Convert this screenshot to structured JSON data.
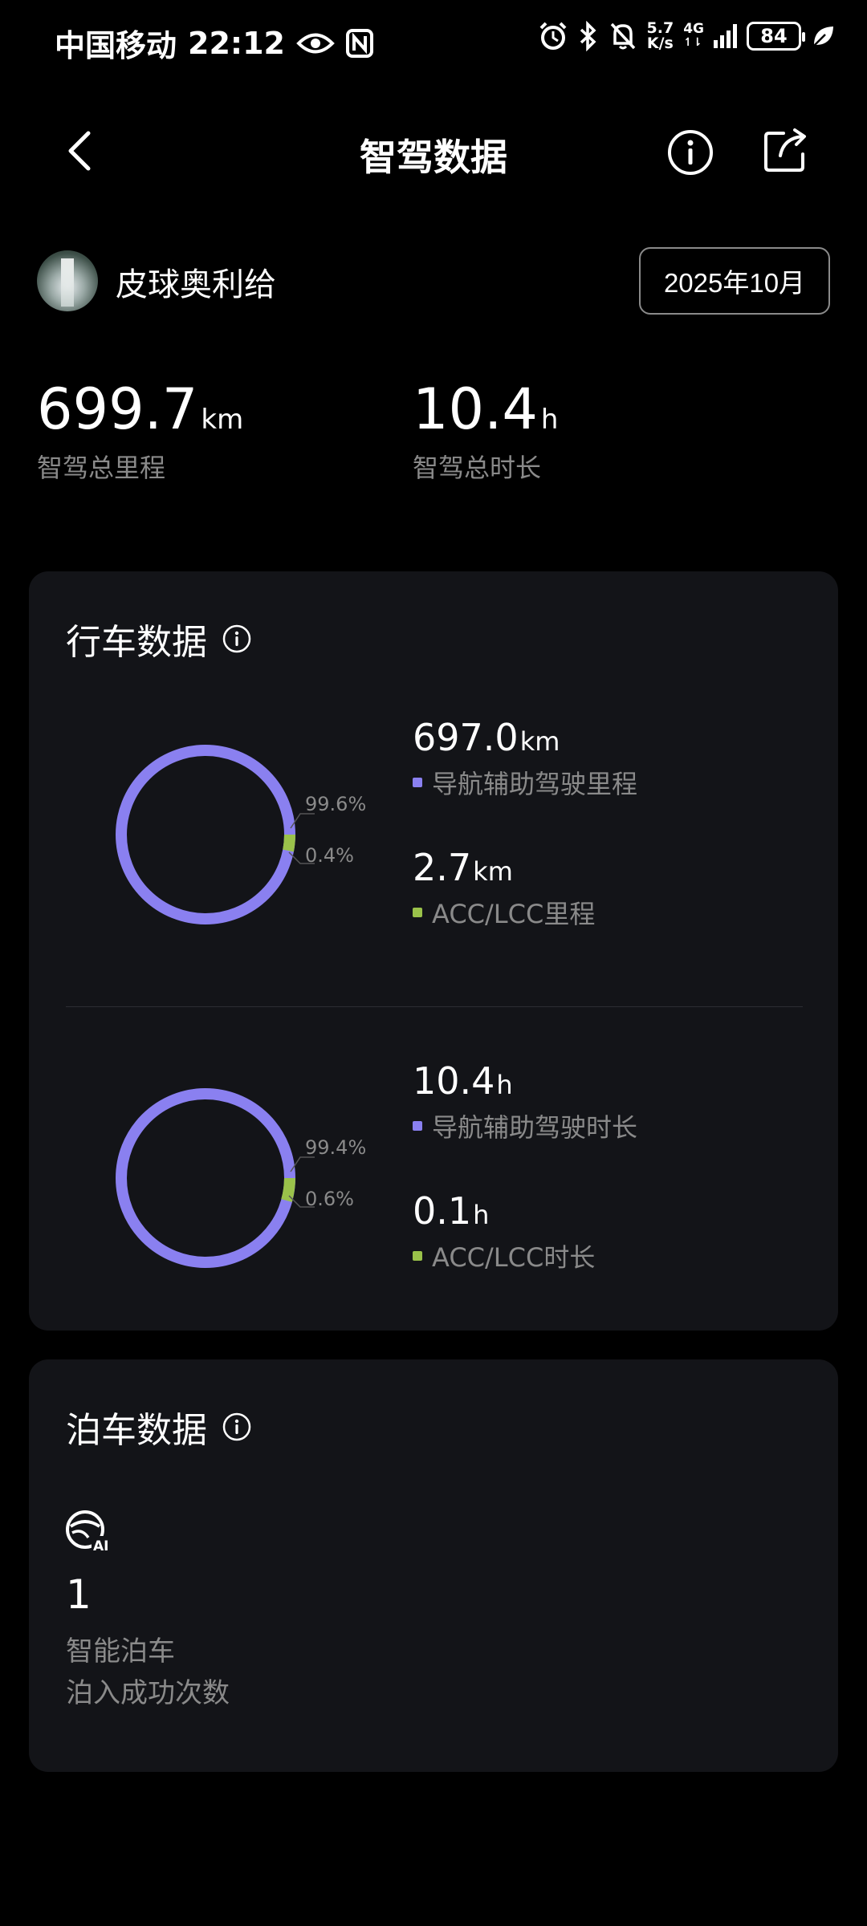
{
  "status_bar": {
    "carrier": "中国移动",
    "time": "22:12",
    "speed_top": "5.7",
    "speed_bottom": "K/s",
    "network": "4G",
    "battery": "84",
    "icons": [
      "eye-icon",
      "nfc-icon",
      "alarm-icon",
      "bluetooth-icon",
      "mute-bell-icon",
      "signal-icon",
      "battery-icon",
      "leaf-icon"
    ]
  },
  "header": {
    "title": "智驾数据",
    "back_icon": "back-arrow-icon",
    "info_icon": "info-icon",
    "share_icon": "share-icon"
  },
  "user": {
    "name": "皮球奥利给",
    "month": "2025年10月"
  },
  "totals": {
    "distance_value": "699.7",
    "distance_unit": "km",
    "distance_label": "智驾总里程",
    "duration_value": "10.4",
    "duration_unit": "h",
    "duration_label": "智驾总时长"
  },
  "driving": {
    "title": "行车数据",
    "colors": {
      "nav": "#8a80f0",
      "acc": "#9ac24a"
    },
    "distance": {
      "nav_pct": "99.6%",
      "acc_pct": "0.4%",
      "nav_value": "697.0",
      "nav_unit": "km",
      "nav_label": "导航辅助驾驶里程",
      "acc_value": "2.7",
      "acc_unit": "km",
      "acc_label": "ACC/LCC里程"
    },
    "duration": {
      "nav_pct": "99.4%",
      "acc_pct": "0.6%",
      "nav_value": "10.4",
      "nav_unit": "h",
      "nav_label": "导航辅助驾驶时长",
      "acc_value": "0.1",
      "acc_unit": "h",
      "acc_label": "ACC/LCC时长"
    }
  },
  "parking": {
    "title": "泊车数据",
    "icon": "ai-parking-icon",
    "count": "1",
    "label_line1": "智能泊车",
    "label_line2": "泊入成功次数"
  }
}
